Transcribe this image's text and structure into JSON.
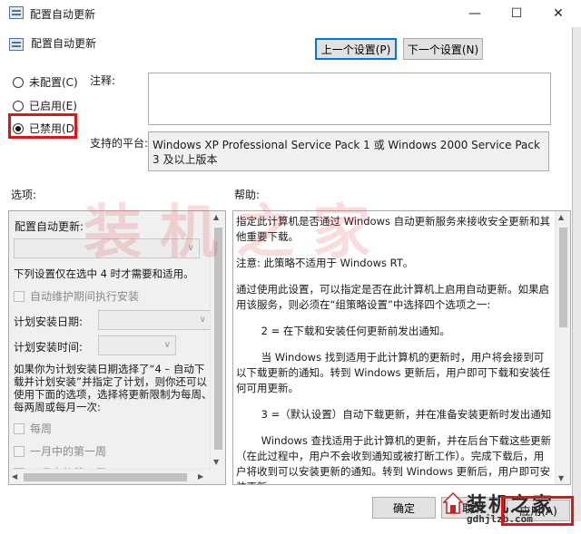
{
  "window": {
    "title": "配置自动更新",
    "header_title": "配置自动更新",
    "minimize": "—",
    "maximize": "☐",
    "close": "✕"
  },
  "nav": {
    "prev_label": "上一个设置(P)",
    "next_label": "下一个设置(N)"
  },
  "state": {
    "options": [
      {
        "label": "未配置(C)",
        "selected": false
      },
      {
        "label": "已启用(E)",
        "selected": false
      },
      {
        "label": "已禁用(D)",
        "selected": true
      }
    ]
  },
  "comment": {
    "label": "注释:",
    "value": ""
  },
  "platform": {
    "label": "支持的平台:",
    "value": "Windows XP Professional Service Pack 1 或 Windows 2000 Service Pack 3 及以上版本"
  },
  "options_section": {
    "label": "选项:",
    "configure_label": "配置自动更新:",
    "note": "下列设置仅在选中 4 时才需要和适用。",
    "maintenance_checkbox": "自动维护期间执行安装",
    "schedule_day_label": "计划安装日期:",
    "schedule_time_label": "计划安装时间:",
    "long_note": "如果你为计划安装日期选择了“4 – 自动下载并计划安装”并指定了计划，则你还可以使用下面的选项，选择将更新限制为每周、每两周或每月一次:",
    "weekly_checkbox": "每周",
    "first_week_checkbox": "一月中的第一周",
    "second_week_checkbox": "一月中的第二周"
  },
  "help_section": {
    "label": "帮助:",
    "paragraphs": [
      "指定此计算机是否通过 Windows 自动更新服务来接收安全更新和其他重要下载。",
      "注意: 此策略不适用于 Windows RT。",
      "通过使用此设置，可以指定是否在此计算机上启用自动更新。如果启用该服务，则必须在“组策略设置”中选择四个选项之一:",
      "2 = 在下载和安装任何更新前发出通知。",
      "当 Windows 找到适用于此计算机的更新时，用户将会接到可以下载更新的通知。转到 Windows 更新后，用户即可下载和安装任何可用更新。",
      "3 =（默认设置）自动下载更新，并在准备安装更新时发出通知",
      "Windows 查找适用于此计算机的更新，并在后台下载这些更新（在此过程中，用户不会收到通知或被打断工作）。完成下载后，用户将收到可以安装更新的通知。转到 Windows 更新后，用户即可安装更新。"
    ]
  },
  "footer": {
    "ok_label": "确定",
    "cancel_label": "取消",
    "apply_label": "应用(A)"
  },
  "watermark": {
    "text": "装机之家",
    "logo_cn": "装机之家",
    "logo_url": "gdhjlzb.com"
  },
  "colors": {
    "highlight": "#e01414",
    "focus": "#0078d7"
  }
}
